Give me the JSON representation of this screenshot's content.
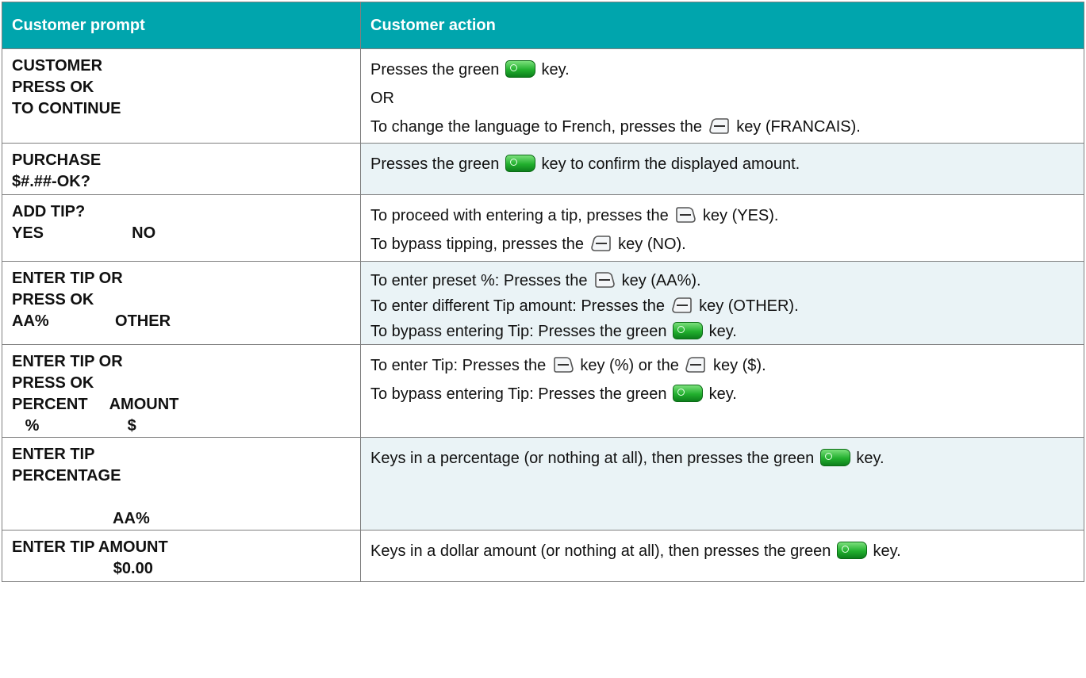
{
  "header": {
    "col1": "Customer prompt",
    "col2": "Customer action"
  },
  "colors": {
    "header_bg": "#00a5ad",
    "alt_row_bg": "#eaf3f6",
    "green_key": "#22b02e"
  },
  "rows": [
    {
      "prompt": [
        "CUSTOMER",
        "PRESS OK",
        "TO CONTINUE"
      ],
      "action": [
        {
          "before": "Presses the green",
          "key": "green-ok-key-icon",
          "after": "key."
        },
        {
          "before": "OR"
        },
        {
          "before": "To change the language to French, presses the",
          "key": "right-soft-key-icon",
          "after": "key (FRANCAIS)."
        }
      ]
    },
    {
      "prompt": [
        "PURCHASE",
        "$#.##-OK?"
      ],
      "action": [
        {
          "before": "Presses the green",
          "key": "green-ok-key-icon",
          "after": "key to confirm the displayed amount."
        }
      ]
    },
    {
      "prompt": [
        "ADD TIP?",
        "YES                    NO"
      ],
      "action": [
        {
          "before": "To proceed with entering a tip, presses the",
          "key": "left-soft-key-icon",
          "after": "key (YES)."
        },
        {
          "before": "To bypass tipping, presses the",
          "key": "right-soft-key-icon",
          "after": "key (NO)."
        }
      ]
    },
    {
      "prompt": [
        "ENTER TIP OR",
        "PRESS OK",
        "AA%               OTHER"
      ],
      "action": [
        {
          "before": "To enter preset %: Presses the",
          "key": "left-soft-key-icon",
          "after": "key (AA%)."
        },
        {
          "before": "To enter different Tip amount: Presses the",
          "key": "right-soft-key-icon",
          "after": "key (OTHER)."
        },
        {
          "before": "To bypass entering Tip: Presses the green",
          "key": "green-ok-key-icon",
          "after": "key."
        }
      ]
    },
    {
      "prompt": [
        "ENTER TIP OR",
        "PRESS OK",
        "PERCENT     AMOUNT",
        "   %                    $"
      ],
      "action": [
        {
          "before": "To enter Tip: Presses the",
          "key": "left-soft-key-icon",
          "after": "key (%) or the",
          "key2": "right-soft-key-icon",
          "after2": "key ($)."
        },
        {
          "before": "To bypass entering Tip: Presses the green",
          "key": "green-ok-key-icon",
          "after": "key."
        }
      ]
    },
    {
      "prompt": [
        "ENTER TIP",
        "PERCENTAGE",
        "",
        "                       AA%"
      ],
      "action": [
        {
          "before": "Keys in a percentage (or nothing at all), then presses the green",
          "key": "green-ok-key-icon",
          "after": "key."
        }
      ]
    },
    {
      "prompt": [
        "ENTER TIP AMOUNT",
        "                       $0.00"
      ],
      "action": [
        {
          "before": "Keys in a dollar amount (or nothing at all), then presses the green",
          "key": "green-ok-key-icon",
          "after": "key."
        }
      ]
    }
  ]
}
